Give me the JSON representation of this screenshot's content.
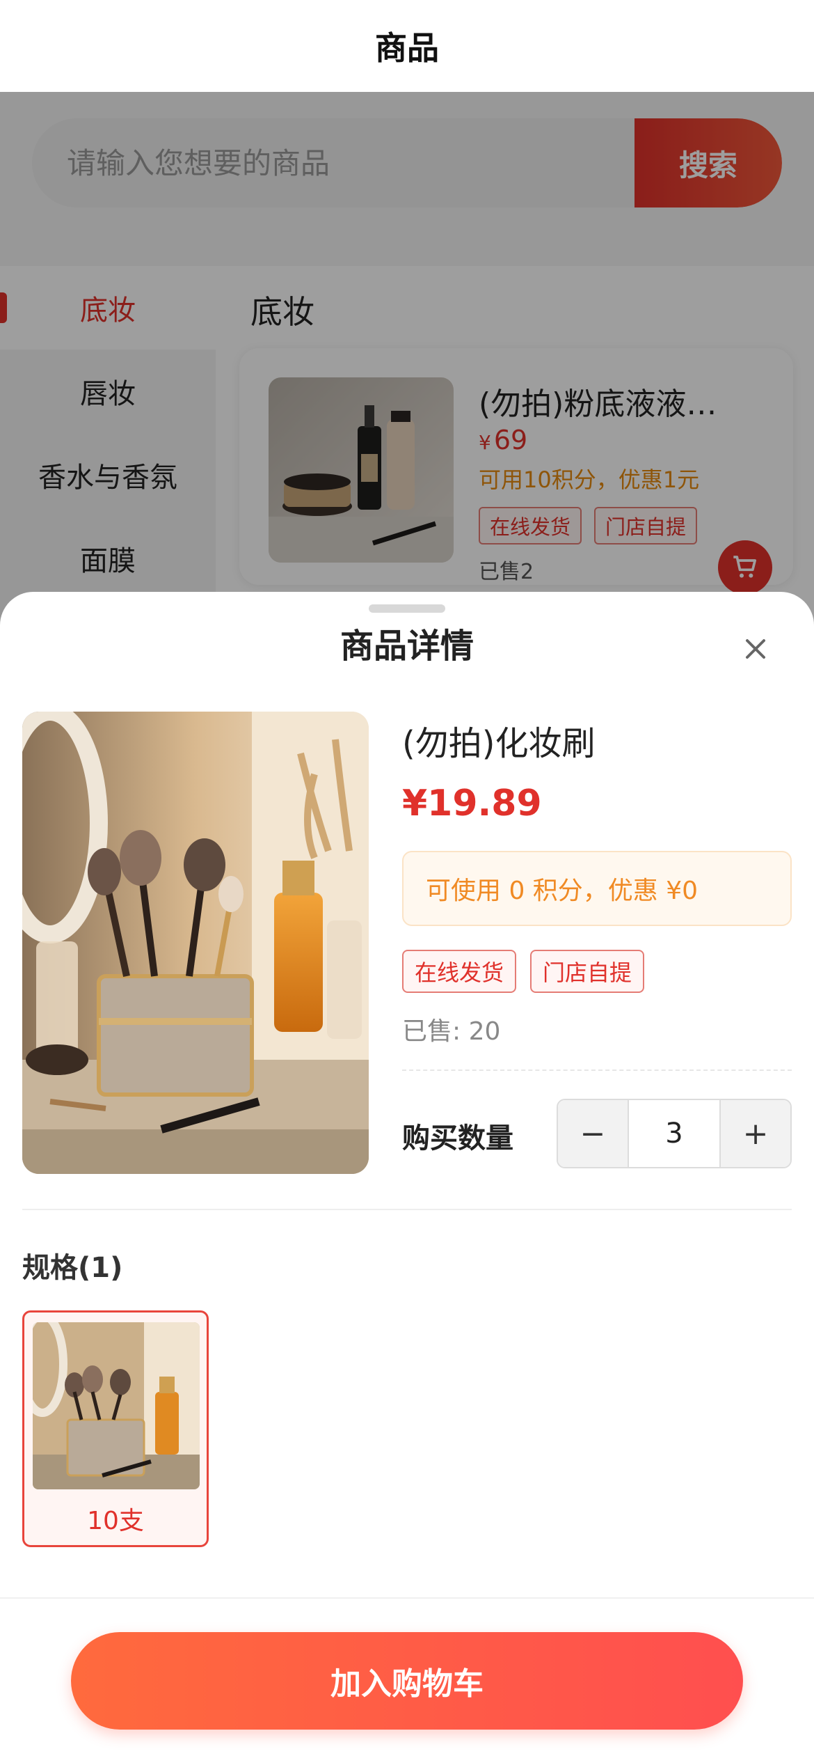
{
  "header": {
    "title": "商品"
  },
  "search": {
    "placeholder": "请输入您想要的商品",
    "button_label": "搜索"
  },
  "sidebar": {
    "items": [
      {
        "label": "底妆",
        "active": true
      },
      {
        "label": "唇妆",
        "active": false
      },
      {
        "label": "香水与香氛",
        "active": false
      },
      {
        "label": "面膜",
        "active": false
      }
    ]
  },
  "category": {
    "heading": "底妆",
    "product": {
      "title": "(勿拍)粉底液液…",
      "price_symbol": "¥",
      "price": "69",
      "points_text": "可用10积分，优惠1元",
      "tags": [
        "在线发货",
        "门店自提"
      ],
      "sold": "已售2",
      "cart_icon": "cart-icon"
    }
  },
  "sheet": {
    "title": "商品详情",
    "close_icon": "close-icon",
    "product_name": "(勿拍)化妆刷",
    "price": "¥19.89",
    "points_text": "可使用 0 积分，优惠 ¥0",
    "tags": [
      "在线发货",
      "门店自提"
    ],
    "sold": "已售: 20",
    "quantity_label": "购买数量",
    "quantity": "3",
    "minus_label": "−",
    "plus_label": "+",
    "spec_heading": "规格(1)",
    "specs": [
      {
        "label": "10支",
        "selected": true
      }
    ],
    "add_to_cart_label": "加入购物车"
  },
  "colors": {
    "accent": "#e0312b",
    "points": "#f08a24",
    "button_start": "#ff6a3d",
    "button_end": "#ff4f4f"
  }
}
